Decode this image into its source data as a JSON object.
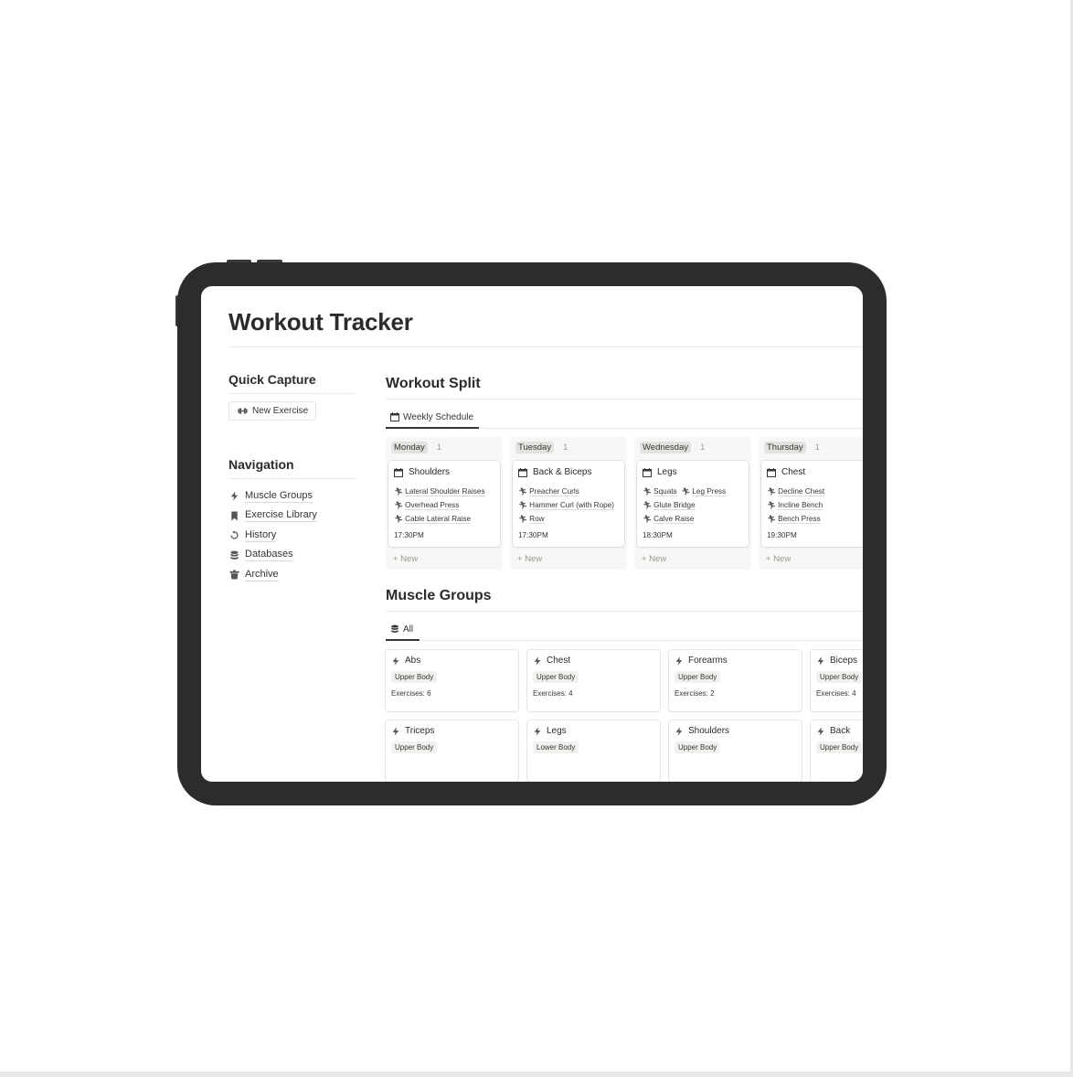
{
  "page": {
    "title": "Workout Tracker"
  },
  "sidebar": {
    "quick_capture": {
      "heading": "Quick Capture",
      "button_label": "New Exercise",
      "button_icon": "dumbbell-icon"
    },
    "navigation": {
      "heading": "Navigation",
      "items": [
        {
          "label": "Muscle Groups",
          "icon": "bolt-icon"
        },
        {
          "label": "Exercise Library",
          "icon": "bookmark-icon"
        },
        {
          "label": "History",
          "icon": "history-icon"
        },
        {
          "label": "Databases",
          "icon": "database-icon"
        },
        {
          "label": "Archive",
          "icon": "trash-icon"
        }
      ]
    }
  },
  "workout_split": {
    "heading": "Workout Split",
    "tab": {
      "label": "Weekly Schedule",
      "icon": "calendar-icon"
    },
    "new_label": "+ New",
    "columns": [
      {
        "day": "Monday",
        "count": "1",
        "card": {
          "title": "Shoulders",
          "exercises": [
            "Lateral Shoulder Raises",
            "Overhead Press",
            "Cable Lateral Raise"
          ],
          "time": "17:30PM"
        }
      },
      {
        "day": "Tuesday",
        "count": "1",
        "card": {
          "title": "Back & Biceps",
          "exercises": [
            "Preacher Curls",
            "Hammer Curl (with Rope)",
            "Row"
          ],
          "time": "17:30PM"
        }
      },
      {
        "day": "Wednesday",
        "count": "1",
        "card": {
          "title": "Legs",
          "exercises": [
            "Squats",
            "Leg Press",
            "Glute Bridge",
            "Calve Raise"
          ],
          "time": "18:30PM"
        }
      },
      {
        "day": "Thursday",
        "count": "1",
        "card": {
          "title": "Chest",
          "exercises": [
            "Decline Chest",
            "Incline Bench",
            "Bench Press"
          ],
          "time": "19:30PM"
        }
      }
    ]
  },
  "muscle_groups": {
    "heading": "Muscle Groups",
    "tab": {
      "label": "All",
      "icon": "database-icon"
    },
    "cards": [
      {
        "name": "Abs",
        "tag": "Upper Body",
        "exercises": "Exercises: 6"
      },
      {
        "name": "Chest",
        "tag": "Upper Body",
        "exercises": "Exercises: 4"
      },
      {
        "name": "Forearms",
        "tag": "Upper Body",
        "exercises": "Exercises: 2"
      },
      {
        "name": "Biceps",
        "tag": "Upper Body",
        "exercises": "Exercises: 4"
      },
      {
        "name": "Triceps",
        "tag": "Upper Body",
        "exercises": ""
      },
      {
        "name": "Legs",
        "tag": "Lower Body",
        "exercises": ""
      },
      {
        "name": "Shoulders",
        "tag": "Upper Body",
        "exercises": ""
      },
      {
        "name": "Back",
        "tag": "Upper Body",
        "exercises": ""
      }
    ]
  },
  "colors": {
    "device_frame": "#2c2c2c",
    "text": "#37352f",
    "tag_bg": "#f1f1ef",
    "column_bg": "#f7f7f5",
    "day_tag_bg": "#e3e2e0"
  }
}
